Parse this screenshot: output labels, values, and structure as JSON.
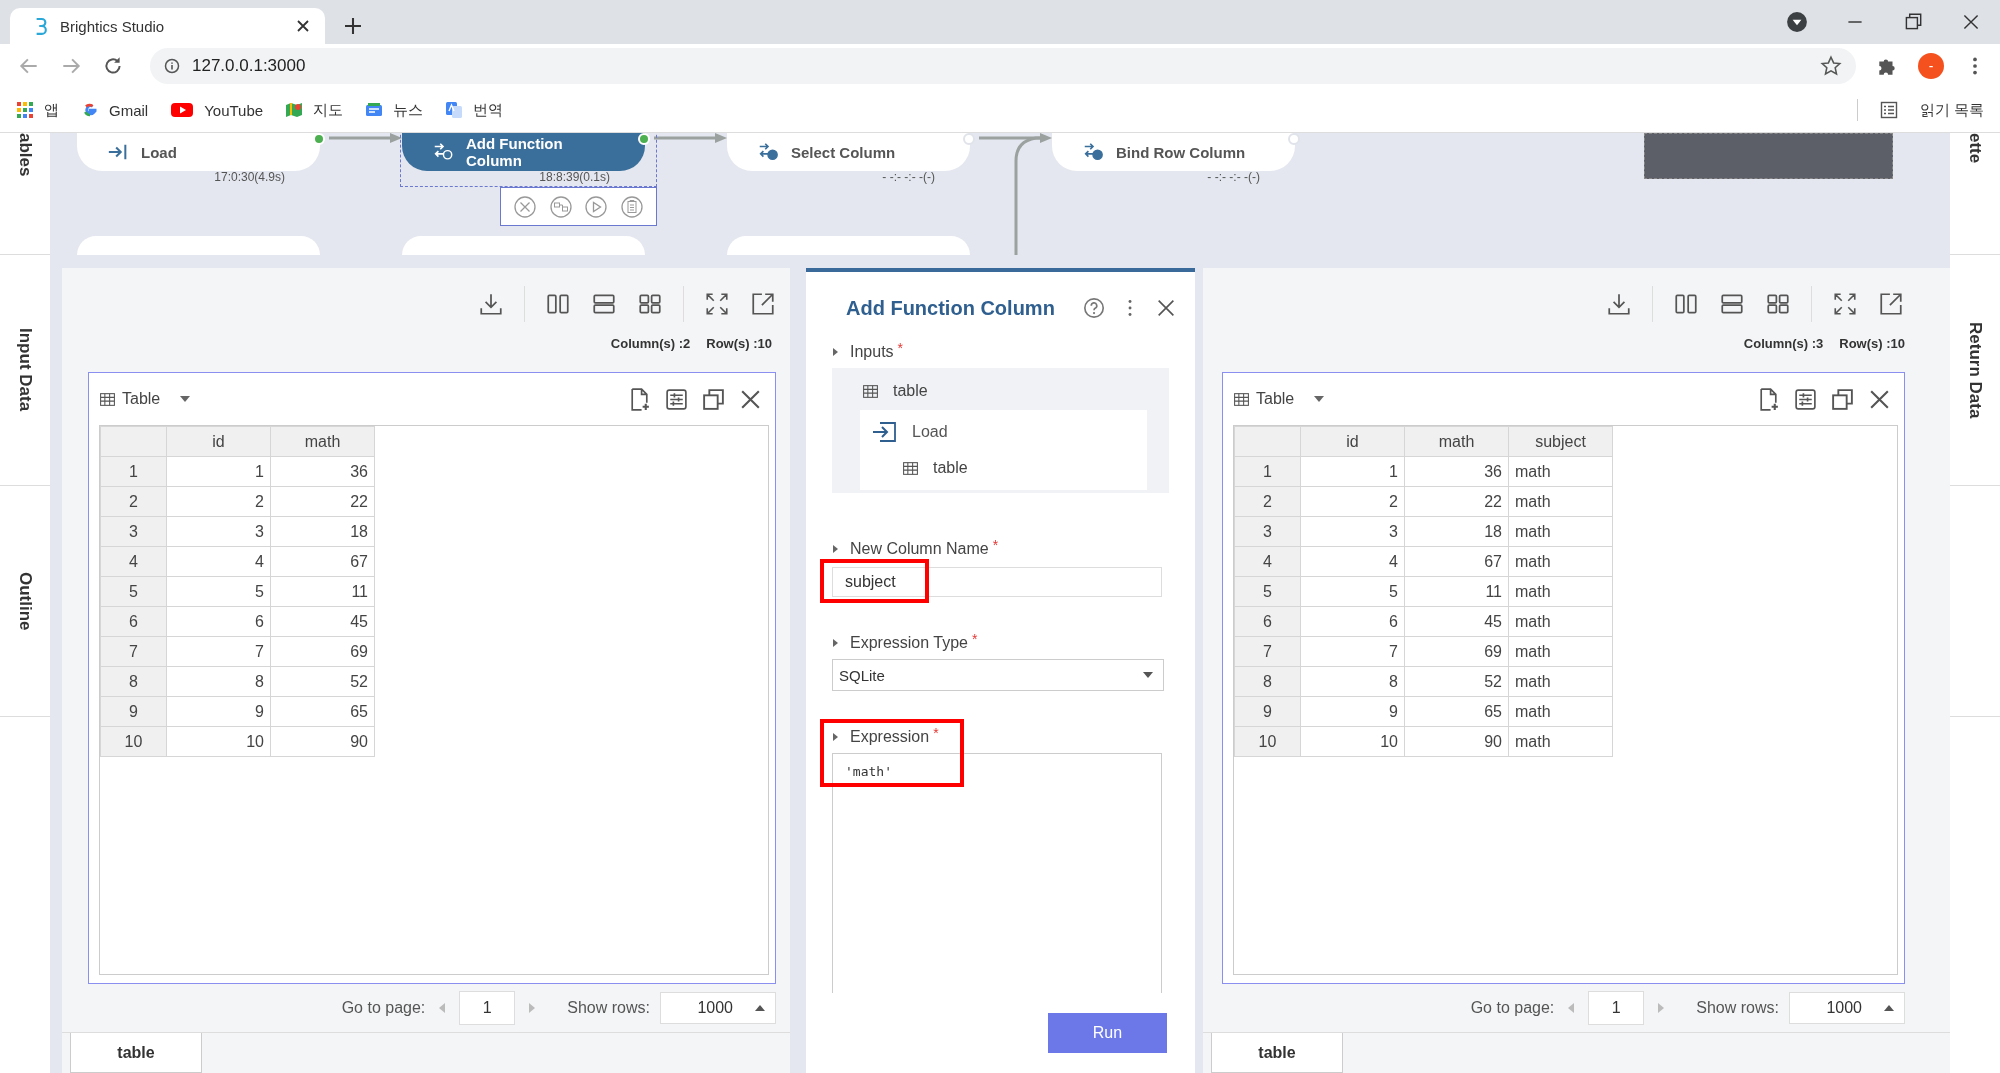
{
  "browser": {
    "tab_title": "Brightics Studio",
    "url": "127.0.0.1:3000",
    "profile_initial": "-",
    "reading_list": "읽기 목록",
    "bookmarks": [
      {
        "label": "앱",
        "kind": "apps"
      },
      {
        "label": "Gmail",
        "kind": "google"
      },
      {
        "label": "YouTube",
        "kind": "youtube"
      },
      {
        "label": "지도",
        "kind": "maps"
      },
      {
        "label": "뉴스",
        "kind": "news"
      },
      {
        "label": "번역",
        "kind": "translate"
      }
    ]
  },
  "left_rail": [
    {
      "label": "ables"
    },
    {
      "label": "Input Data"
    },
    {
      "label": "Outline"
    }
  ],
  "right_rail": [
    {
      "label": "ette"
    },
    {
      "label": "Return Data"
    }
  ],
  "canvas": {
    "nodes": [
      {
        "label": "Load",
        "kind": "load",
        "time": "17:0:30(4.9s)",
        "selected": false,
        "done": true
      },
      {
        "label": "Add Function Column",
        "kind": "function",
        "time": "18:8:39(0.1s)",
        "selected": true,
        "done": true
      },
      {
        "label": "Select Column",
        "kind": "select",
        "time": "- -:- -:- -(-)",
        "selected": false,
        "done": false
      },
      {
        "label": "Bind Row Column",
        "kind": "bind",
        "time": "- -:- -:- -(-)",
        "selected": false,
        "done": false
      }
    ]
  },
  "input_panel": {
    "column_count": "Column(s) :2",
    "row_count": "Row(s) :10",
    "view": "Table",
    "columns": [
      {
        "label": "id",
        "kind": "number"
      },
      {
        "label": "math",
        "kind": "number"
      }
    ],
    "rows": [
      {
        "index": "1",
        "cells": [
          "1",
          "36"
        ]
      },
      {
        "index": "2",
        "cells": [
          "2",
          "22"
        ]
      },
      {
        "index": "3",
        "cells": [
          "3",
          "18"
        ]
      },
      {
        "index": "4",
        "cells": [
          "4",
          "67"
        ]
      },
      {
        "index": "5",
        "cells": [
          "5",
          "11"
        ]
      },
      {
        "index": "6",
        "cells": [
          "6",
          "45"
        ]
      },
      {
        "index": "7",
        "cells": [
          "7",
          "69"
        ]
      },
      {
        "index": "8",
        "cells": [
          "8",
          "52"
        ]
      },
      {
        "index": "9",
        "cells": [
          "9",
          "65"
        ]
      },
      {
        "index": "10",
        "cells": [
          "10",
          "90"
        ]
      }
    ],
    "go_to_page_label": "Go to page:",
    "page": "1",
    "show_rows_label": "Show rows:",
    "show_rows": "1000",
    "tabs": [
      {
        "label": "table",
        "selected": true
      }
    ]
  },
  "function_panel": {
    "title": "Add Function Column",
    "inputs": {
      "label": "Inputs",
      "required_mark": "*",
      "table": "table",
      "source": "Load",
      "source_table": "table"
    },
    "new_column_name": {
      "label": "New Column Name",
      "required_mark": "*",
      "value": "subject",
      "highlighted": true
    },
    "expression_type": {
      "label": "Expression Type",
      "required_mark": "*",
      "value": "SQLite"
    },
    "expression": {
      "label": "Expression",
      "required_mark": "*",
      "value": "'math'",
      "highlighted": true
    },
    "run_button": "Run"
  },
  "output_panel": {
    "column_count": "Column(s) :3",
    "row_count": "Row(s) :10",
    "view": "Table",
    "columns": [
      {
        "label": "id",
        "kind": "number"
      },
      {
        "label": "math",
        "kind": "number"
      },
      {
        "label": "subject",
        "kind": "text"
      }
    ],
    "rows": [
      {
        "index": "1",
        "cells": [
          "1",
          "36",
          "math"
        ]
      },
      {
        "index": "2",
        "cells": [
          "2",
          "22",
          "math"
        ]
      },
      {
        "index": "3",
        "cells": [
          "3",
          "18",
          "math"
        ]
      },
      {
        "index": "4",
        "cells": [
          "4",
          "67",
          "math"
        ]
      },
      {
        "index": "5",
        "cells": [
          "5",
          "11",
          "math"
        ]
      },
      {
        "index": "6",
        "cells": [
          "6",
          "45",
          "math"
        ]
      },
      {
        "index": "7",
        "cells": [
          "7",
          "69",
          "math"
        ]
      },
      {
        "index": "8",
        "cells": [
          "8",
          "52",
          "math"
        ]
      },
      {
        "index": "9",
        "cells": [
          "9",
          "65",
          "math"
        ]
      },
      {
        "index": "10",
        "cells": [
          "10",
          "90",
          "math"
        ]
      }
    ],
    "go_to_page_label": "Go to page:",
    "page": "1",
    "show_rows_label": "Show rows:",
    "show_rows": "1000",
    "tabs": [
      {
        "label": "table",
        "selected": true
      }
    ]
  }
}
